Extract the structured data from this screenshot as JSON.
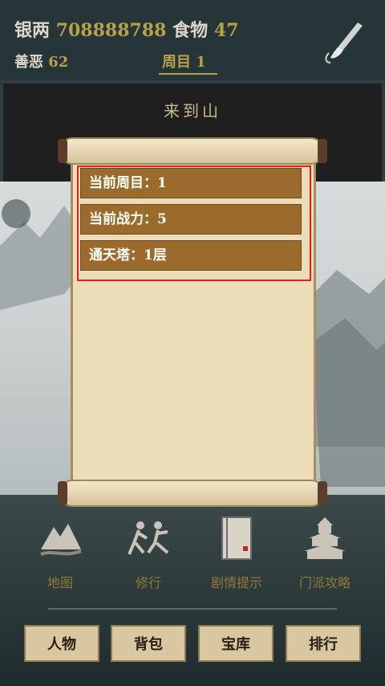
{
  "hud": {
    "silver_label": "银两",
    "silver_value": "708888788",
    "food_label": "食物",
    "food_value": "47",
    "karma_label": "善恶",
    "karma_value": "62",
    "loop_label": "周目",
    "loop_value": "1"
  },
  "banner": {
    "text": "来到山"
  },
  "scroll": {
    "rows": [
      {
        "text": "当前周目：1"
      },
      {
        "text": "当前战力：5"
      },
      {
        "text": "通天塔：1层"
      }
    ]
  },
  "menu": {
    "items": [
      {
        "label": "地图",
        "icon": "map-icon"
      },
      {
        "label": "修行",
        "icon": "training-icon"
      },
      {
        "label": "剧情提示",
        "icon": "story-hint-icon"
      },
      {
        "label": "门派攻略",
        "icon": "sect-guide-icon"
      }
    ]
  },
  "bottom": {
    "buttons": [
      {
        "label": "人物"
      },
      {
        "label": "背包"
      },
      {
        "label": "宝库"
      },
      {
        "label": "排行"
      }
    ]
  }
}
